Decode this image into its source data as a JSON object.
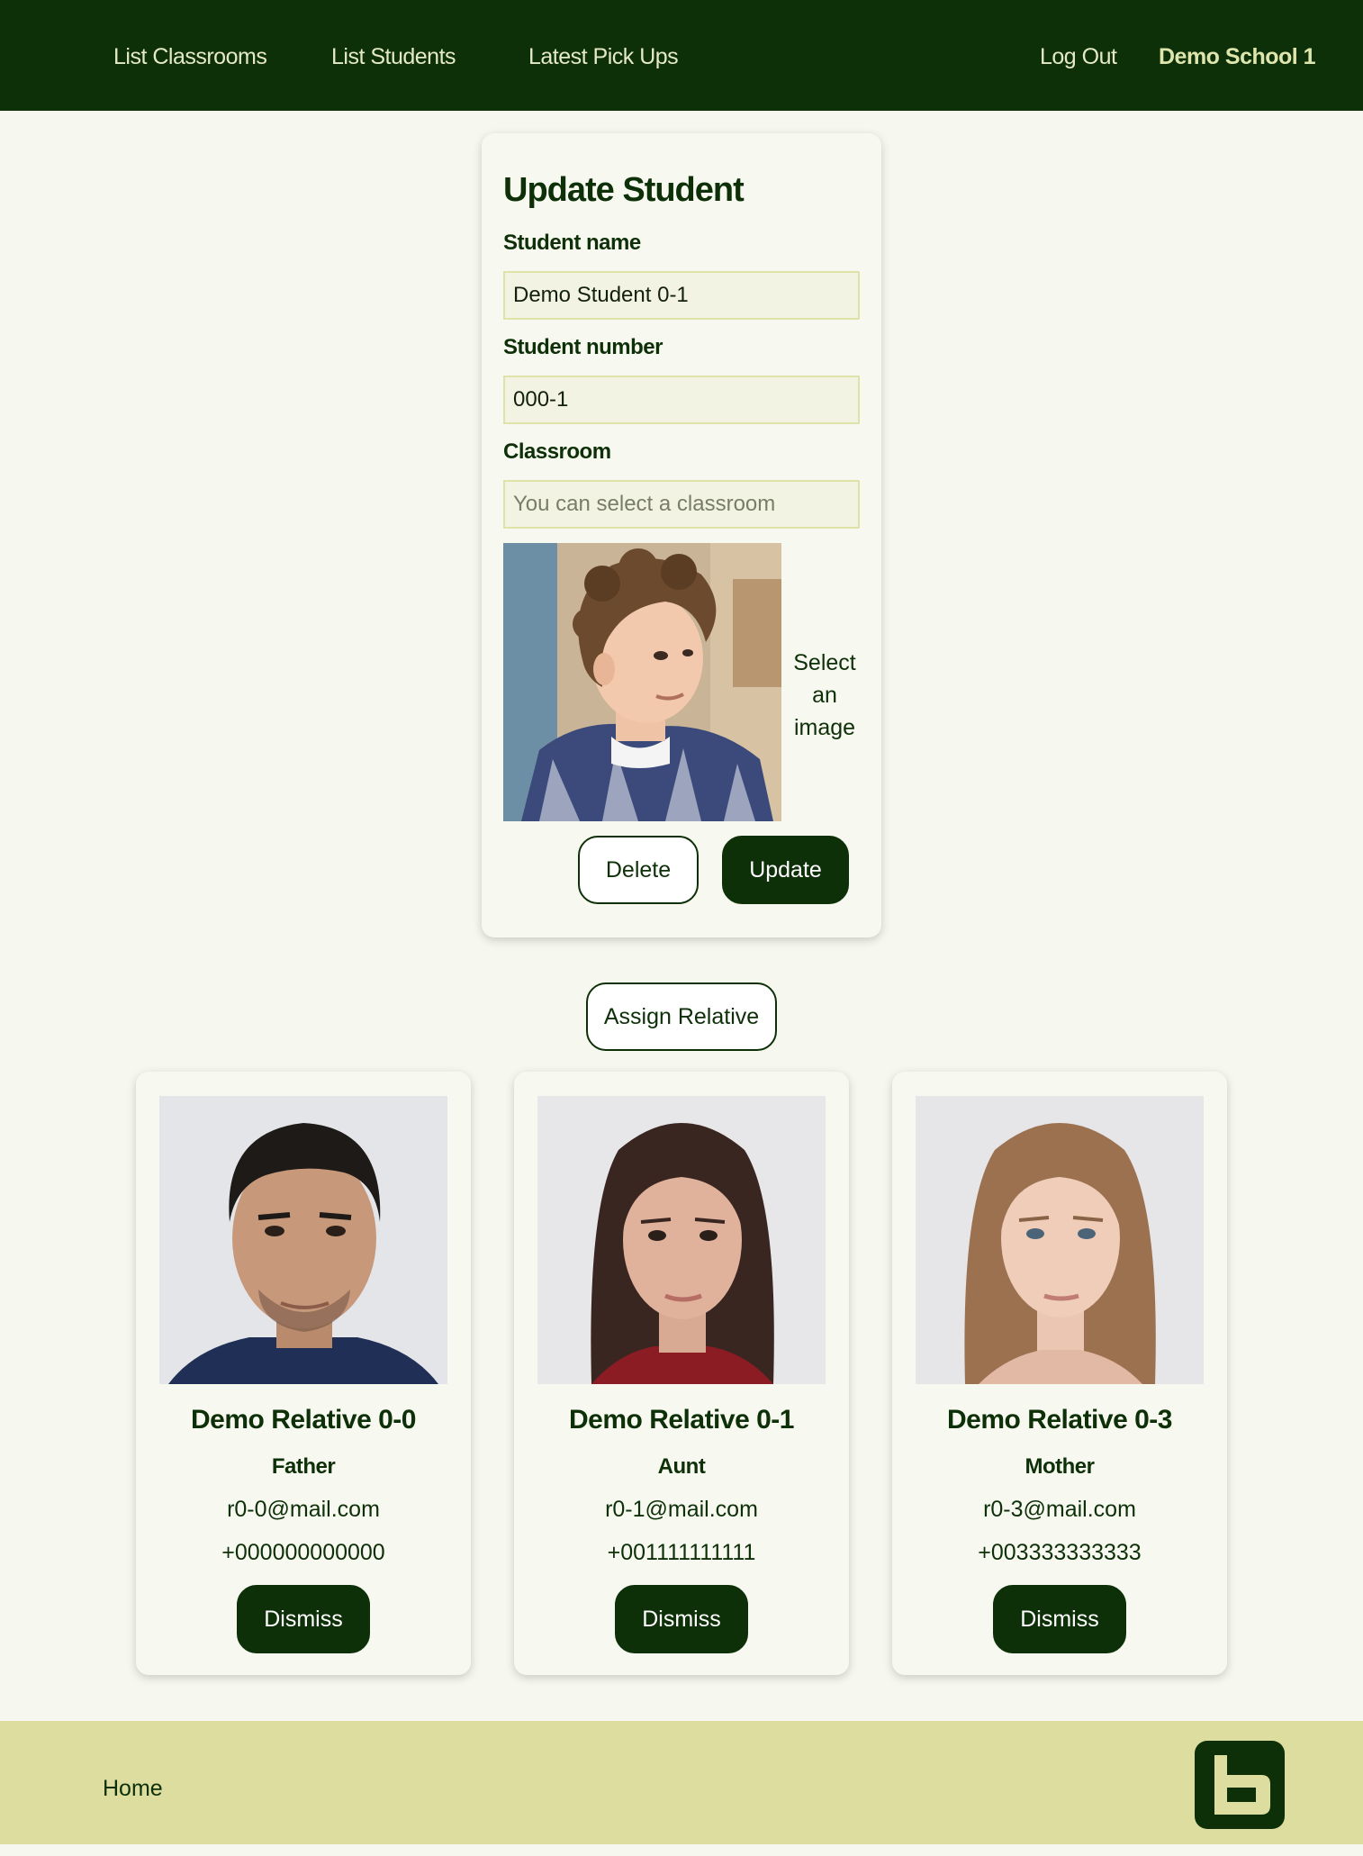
{
  "nav": {
    "items": [
      {
        "label": "List Classrooms"
      },
      {
        "label": "List Students"
      },
      {
        "label": "Latest Pick Ups"
      }
    ],
    "logout": "Log Out",
    "school": "Demo School 1"
  },
  "form": {
    "title": "Update Student",
    "name_label": "Student name",
    "name_value": "Demo Student 0-1",
    "number_label": "Student number",
    "number_value": "000-1",
    "classroom_label": "Classroom",
    "classroom_placeholder": "You can select a classroom",
    "select_image": "Select an image",
    "delete_label": "Delete",
    "update_label": "Update"
  },
  "assign_label": "Assign Relative",
  "relatives": [
    {
      "name": "Demo Relative 0-0",
      "role": "Father",
      "email": "r0-0@mail.com",
      "phone": "+000000000000",
      "dismiss": "Dismiss"
    },
    {
      "name": "Demo Relative 0-1",
      "role": "Aunt",
      "email": "r0-1@mail.com",
      "phone": "+001111111111",
      "dismiss": "Dismiss"
    },
    {
      "name": "Demo Relative 0-3",
      "role": "Mother",
      "email": "r0-3@mail.com",
      "phone": "+003333333333",
      "dismiss": "Dismiss"
    }
  ],
  "footer": {
    "home": "Home"
  },
  "colors": {
    "primary": "#0e3008",
    "background": "#f6f7ee",
    "footer": "#dcdd9e",
    "nav_text": "#e4e9c6"
  }
}
